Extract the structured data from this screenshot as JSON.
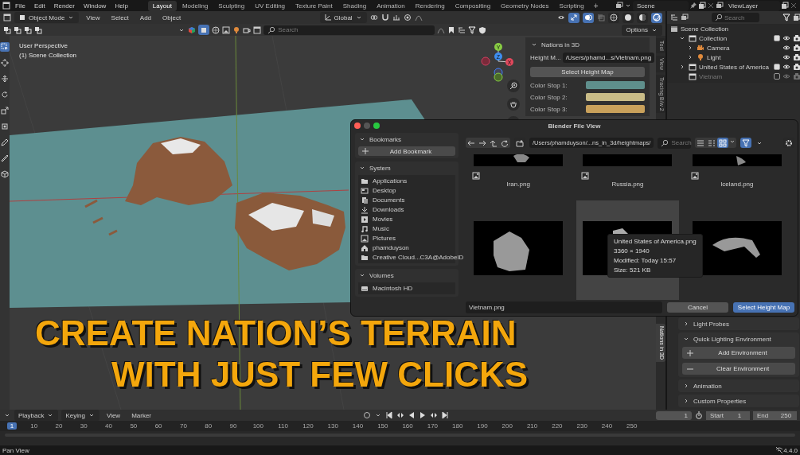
{
  "topbar": {
    "menus": [
      "File",
      "Edit",
      "Render",
      "Window",
      "Help"
    ],
    "workspaces": [
      {
        "label": "Layout",
        "selected": true
      },
      {
        "label": "Modeling",
        "selected": false
      },
      {
        "label": "Sculpting",
        "selected": false
      },
      {
        "label": "UV Editing",
        "selected": false
      },
      {
        "label": "Texture Paint",
        "selected": false
      },
      {
        "label": "Shading",
        "selected": false
      },
      {
        "label": "Animation",
        "selected": false
      },
      {
        "label": "Rendering",
        "selected": false
      },
      {
        "label": "Compositing",
        "selected": false
      },
      {
        "label": "Geometry Nodes",
        "selected": false
      },
      {
        "label": "Scripting",
        "selected": false
      }
    ],
    "add_tab": "+",
    "scene": "Scene",
    "view_layer": "ViewLayer"
  },
  "viewport": {
    "mode": "Object Mode",
    "menus": [
      "View",
      "Select",
      "Add",
      "Object"
    ],
    "orientation": "Global",
    "search_placeholder": "Search",
    "options": "Options",
    "shading": [
      {
        "kind": "wire",
        "selected": false
      },
      {
        "kind": "solid",
        "selected": false
      },
      {
        "kind": "material",
        "selected": false
      },
      {
        "kind": "rendered",
        "selected": true
      }
    ],
    "perspective": "User Perspective",
    "collection": "(1) Scene Collection",
    "gizmo": {
      "x": "X",
      "y": "Y",
      "z": "Z"
    },
    "npanel": {
      "title": "Nations in 3D",
      "height_map_label": "Height M...",
      "height_map_path": "/Users/phamd...s/Vietnam.png",
      "select_button": "Select Height Map",
      "color_stops": [
        {
          "label": "Color Stop 1:",
          "color": "#5f8f8c"
        },
        {
          "label": "Color Stop 2:",
          "color": "#c9bc87"
        },
        {
          "label": "Color Stop 3:",
          "color": "#c9a15b"
        }
      ]
    },
    "side_tabs": [
      {
        "label": "Tool",
        "selected": false
      },
      {
        "label": "View",
        "selected": false
      },
      {
        "label": "Tracing B/w 2",
        "selected": false
      },
      {
        "label": "Nations in 3D",
        "selected": true
      }
    ]
  },
  "headline": [
    "CREATE NATION’S TERRAIN",
    "WITH JUST FEW CLICKS"
  ],
  "outliner": {
    "search_placeholder": "Search",
    "tree": [
      {
        "label": "Scene Collection",
        "kind": "scene",
        "disabled": false,
        "children": [
          {
            "label": "Collection",
            "kind": "collection",
            "expanded": true,
            "checked": true,
            "disabled": false,
            "children": [
              {
                "label": "Camera",
                "kind": "camera",
                "expanded": false,
                "disabled": false
              },
              {
                "label": "Light",
                "kind": "light",
                "expanded": false,
                "disabled": false
              }
            ]
          },
          {
            "label": "United States of America",
            "kind": "collection",
            "expanded": false,
            "checked": true,
            "disabled": false
          },
          {
            "label": "Vietnam",
            "kind": "collection",
            "checked": false,
            "disabled": true
          }
        ]
      }
    ]
  },
  "properties": {
    "panels": [
      {
        "label": "Light Probes",
        "expanded": false
      },
      {
        "label": "Quick Lighting Environment",
        "expanded": true,
        "buttons": [
          {
            "kind": "add",
            "label": "Add Environment"
          },
          {
            "kind": "remove",
            "label": "Clear Environment"
          }
        ]
      },
      {
        "label": "Animation",
        "expanded": false
      },
      {
        "label": "Custom Properties",
        "expanded": false
      }
    ]
  },
  "dialog": {
    "title": "Blender File View",
    "sections": [
      {
        "title": "Bookmarks",
        "button": "Add Bookmark"
      },
      {
        "title": "System",
        "items": [
          {
            "kind": "folder",
            "label": "Applications"
          },
          {
            "kind": "desktop",
            "label": "Desktop"
          },
          {
            "kind": "documents",
            "label": "Documents"
          },
          {
            "kind": "download",
            "label": "Downloads"
          },
          {
            "kind": "movie",
            "label": "Movies"
          },
          {
            "kind": "music",
            "label": "Music"
          },
          {
            "kind": "picture",
            "label": "Pictures"
          },
          {
            "kind": "home",
            "label": "phamduyson"
          },
          {
            "kind": "folder",
            "label": "Creative Cloud...C3A@AdobeID"
          }
        ]
      },
      {
        "title": "Volumes",
        "items": [
          {
            "kind": "disk",
            "label": "Macintosh HD"
          }
        ]
      }
    ],
    "path": "/Users/phamduyson/...ns_in_3d/heightmaps/",
    "search_placeholder": "Search",
    "view_modes": [
      {
        "kind": "list",
        "selected": false
      },
      {
        "kind": "detail",
        "selected": false
      },
      {
        "kind": "grid",
        "selected": true
      }
    ],
    "filter_on": true,
    "files": [
      {
        "label": "Iran.png",
        "selected": false
      },
      {
        "label": "Russia.png",
        "selected": false
      },
      {
        "label": "Iceland.png",
        "selected": false
      },
      {
        "selected": false
      },
      {
        "selected": true
      },
      {
        "selected": false
      }
    ],
    "tooltip": {
      "name": "United States of America.png",
      "dimensions": "3360 × 1940",
      "modified": "Modified: Today 15:57",
      "size": "Size: 521 KB"
    },
    "filename": "Vietnam.png",
    "cancel": "Cancel",
    "confirm": "Select Height Map"
  },
  "timeline": {
    "menus": [
      "Playback",
      "Keying",
      "View",
      "Marker"
    ],
    "frame": "1",
    "start_label": "Start",
    "start": "1",
    "end_label": "End",
    "end": "250",
    "current_frame": "1",
    "ticks": [
      "10",
      "20",
      "30",
      "40",
      "50",
      "60",
      "70",
      "80",
      "90",
      "100",
      "110",
      "120",
      "130",
      "140",
      "150",
      "160",
      "170",
      "180",
      "190",
      "200",
      "210",
      "220",
      "230",
      "240",
      "250"
    ]
  },
  "status_bar": {
    "left": "Pan View",
    "version": "4.4.0"
  }
}
